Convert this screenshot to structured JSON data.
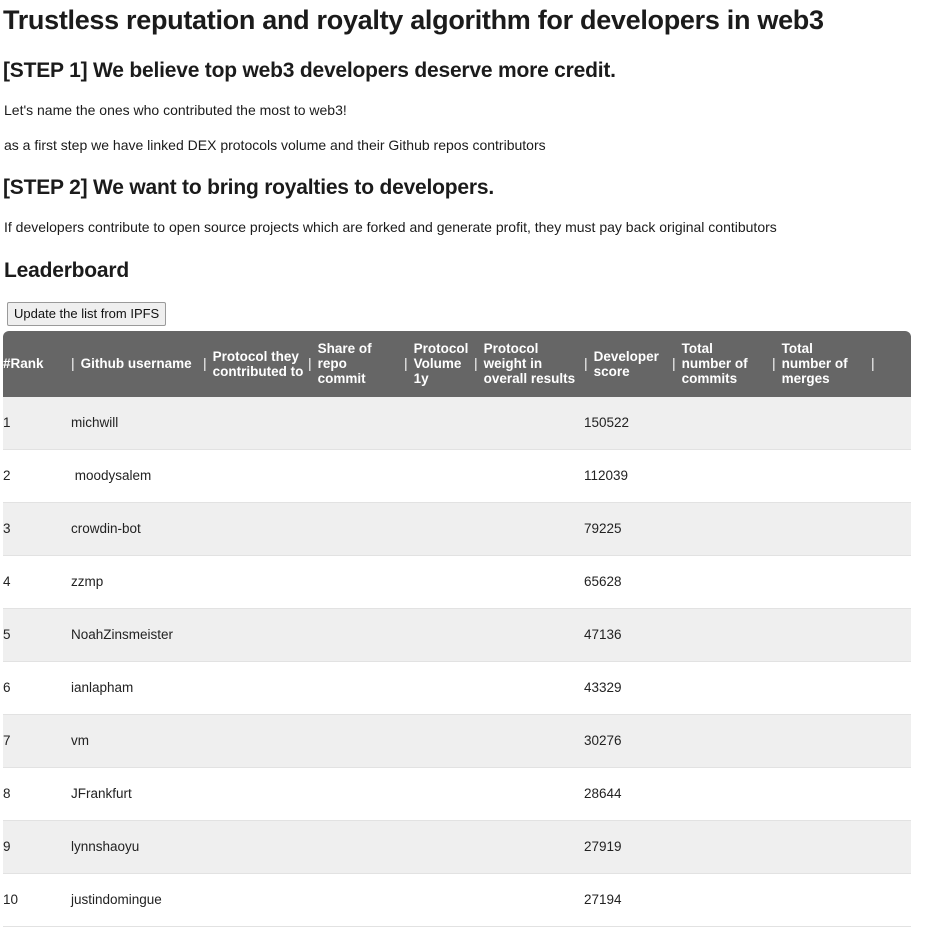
{
  "page": {
    "title": "Trustless reputation and royalty algorithm for developers in web3",
    "step1_heading": "[STEP 1] We believe top web3 developers deserve more credit.",
    "step1_line1": "Let's name the ones who contributed the most to web3!",
    "step1_line2": "as a first step we have linked DEX protocols volume and their Github repos contributors",
    "step2_heading": "[STEP 2] We want to bring royalties to developers.",
    "step2_line1": "If developers contribute to open source projects which are forked and generate profit, they must pay back original contibutors",
    "leaderboard_heading": "Leaderboard"
  },
  "toolbar": {
    "update_button_label": "Update the list from IPFS"
  },
  "colors": {
    "table_header_bg": "#666666",
    "table_header_text": "#ffffff",
    "row_odd_bg": "#efefef",
    "row_even_bg": "#ffffff",
    "button_bg": "#efefef",
    "text": "#1b1b1b"
  },
  "table": {
    "column_separator": "|",
    "columns": [
      {
        "key": "rank",
        "label": "#Rank",
        "separator_before": false
      },
      {
        "key": "user",
        "label": "Github username",
        "separator_before": true
      },
      {
        "key": "proto",
        "label": "Protocol they\ncontributed to",
        "separator_before": true
      },
      {
        "key": "share",
        "label": "Share of repo\ncommit",
        "separator_before": true
      },
      {
        "key": "vol",
        "label": "Protocol\nVolume 1y",
        "separator_before": true
      },
      {
        "key": "weight",
        "label": "Protocol\nweight in\noverall results",
        "separator_before": true
      },
      {
        "key": "dev",
        "label": "Developer\nscore",
        "separator_before": true
      },
      {
        "key": "commits",
        "label": "Total\nnumber of\ncommits",
        "separator_before": true
      },
      {
        "key": "merges",
        "label": "Total\nnumber of\nmerges",
        "separator_before": true
      },
      {
        "key": "tail",
        "label": "",
        "separator_before": true
      }
    ],
    "rows": [
      {
        "rank": "1",
        "user": "michwill",
        "proto": "",
        "share": "",
        "vol": "",
        "weight": "",
        "dev": "150522",
        "commits": "",
        "merges": "",
        "tail": ""
      },
      {
        "rank": "2",
        "user": " moodysalem",
        "proto": "",
        "share": "",
        "vol": "",
        "weight": "",
        "dev": "112039",
        "commits": "",
        "merges": "",
        "tail": ""
      },
      {
        "rank": "3",
        "user": "crowdin-bot",
        "proto": "",
        "share": "",
        "vol": "",
        "weight": "",
        "dev": "79225",
        "commits": "",
        "merges": "",
        "tail": ""
      },
      {
        "rank": "4",
        "user": "zzmp",
        "proto": "",
        "share": "",
        "vol": "",
        "weight": "",
        "dev": "65628",
        "commits": "",
        "merges": "",
        "tail": ""
      },
      {
        "rank": "5",
        "user": "NoahZinsmeister",
        "proto": "",
        "share": "",
        "vol": "",
        "weight": "",
        "dev": "47136",
        "commits": "",
        "merges": "",
        "tail": ""
      },
      {
        "rank": "6",
        "user": "ianlapham",
        "proto": "",
        "share": "",
        "vol": "",
        "weight": "",
        "dev": "43329",
        "commits": "",
        "merges": "",
        "tail": ""
      },
      {
        "rank": "7",
        "user": "vm",
        "proto": "",
        "share": "",
        "vol": "",
        "weight": "",
        "dev": "30276",
        "commits": "",
        "merges": "",
        "tail": ""
      },
      {
        "rank": "8",
        "user": "JFrankfurt",
        "proto": "",
        "share": "",
        "vol": "",
        "weight": "",
        "dev": "28644",
        "commits": "",
        "merges": "",
        "tail": ""
      },
      {
        "rank": "9",
        "user": "lynnshaoyu",
        "proto": "",
        "share": "",
        "vol": "",
        "weight": "",
        "dev": "27919",
        "commits": "",
        "merges": "",
        "tail": ""
      },
      {
        "rank": "10",
        "user": "justindomingue",
        "proto": "",
        "share": "",
        "vol": "",
        "weight": "",
        "dev": "27194",
        "commits": "",
        "merges": "",
        "tail": ""
      }
    ]
  }
}
